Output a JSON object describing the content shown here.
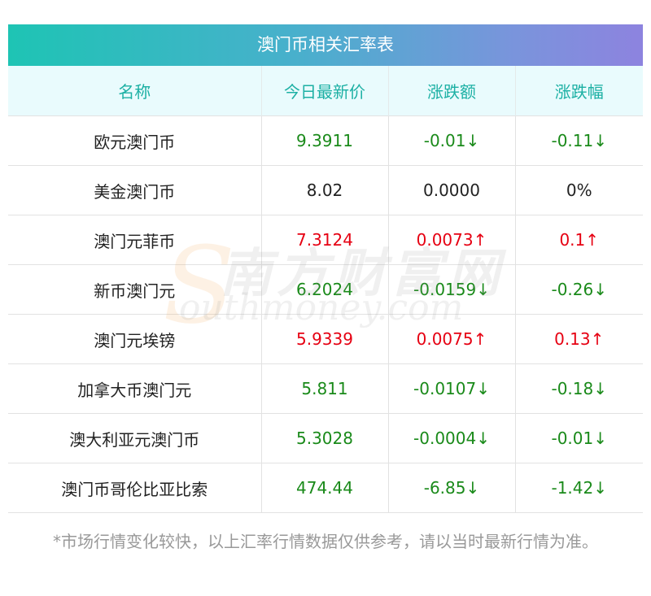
{
  "title": "澳门币相关汇率表",
  "columns": [
    "名称",
    "今日最新价",
    "涨跌额",
    "涨跌幅"
  ],
  "rows": [
    {
      "name": "欧元澳门币",
      "price": "9.3911",
      "change": "-0.01↓",
      "pct": "-0.11↓",
      "dir": "down"
    },
    {
      "name": "美金澳门币",
      "price": "8.02",
      "change": "0.0000",
      "pct": "0%",
      "dir": "flat"
    },
    {
      "name": "澳门元菲币",
      "price": "7.3124",
      "change": "0.0073↑",
      "pct": "0.1↑",
      "dir": "up"
    },
    {
      "name": "新币澳门元",
      "price": "6.2024",
      "change": "-0.0159↓",
      "pct": "-0.26↓",
      "dir": "down"
    },
    {
      "name": "澳门元埃镑",
      "price": "5.9339",
      "change": "0.0075↑",
      "pct": "0.13↑",
      "dir": "up"
    },
    {
      "name": "加拿大币澳门元",
      "price": "5.811",
      "change": "-0.0107↓",
      "pct": "-0.18↓",
      "dir": "down"
    },
    {
      "name": "澳大利亚元澳门币",
      "price": "5.3028",
      "change": "-0.0004↓",
      "pct": "-0.01↓",
      "dir": "down"
    },
    {
      "name": "澳门币哥伦比亚比索",
      "price": "474.44",
      "change": "-6.85↓",
      "pct": "-1.42↓",
      "dir": "down"
    }
  ],
  "note": "*市场行情变化较快，以上汇率行情数据仅供参考，请以当时最新行情为准。",
  "watermark": {
    "cn": "南方财富网",
    "en": "outhmoney.com",
    "s": "S"
  },
  "colors": {
    "up": "#e60012",
    "down": "#1a8a1a",
    "header_text": "#1cb0a4",
    "header_bg": "#e9fbfd"
  }
}
